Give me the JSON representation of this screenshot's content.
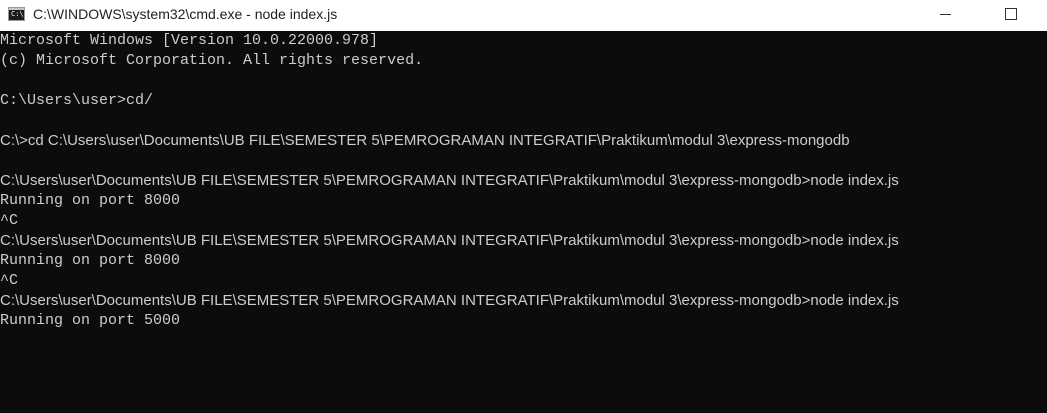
{
  "window": {
    "title": "C:\\WINDOWS\\system32\\cmd.exe - node  index.js",
    "icon": "cmd-icon",
    "icon_glyph": "C:\\",
    "controls": [
      "minimize-icon",
      "maximize-icon"
    ]
  },
  "colors": {
    "console_bg": "#0c0c0c",
    "console_text": "#cccccc",
    "titlebar_bg": "#ffffff"
  },
  "console": {
    "lines": [
      "Microsoft Windows [Version 10.0.22000.978]",
      "(c) Microsoft Corporation. All rights reserved.",
      "",
      "C:\\Users\\user>cd/",
      "",
      "C:\\>cd C:\\Users\\user\\Documents\\UB FILE\\SEMESTER 5\\PEMROGRAMAN INTEGRATIF\\Praktikum\\modul 3\\express-mongodb",
      "",
      "C:\\Users\\user\\Documents\\UB FILE\\SEMESTER 5\\PEMROGRAMAN INTEGRATIF\\Praktikum\\modul 3\\express-mongodb>node index.js",
      "Running on port 8000",
      "^C",
      "C:\\Users\\user\\Documents\\UB FILE\\SEMESTER 5\\PEMROGRAMAN INTEGRATIF\\Praktikum\\modul 3\\express-mongodb>node index.js",
      "Running on port 8000",
      "^C",
      "C:\\Users\\user\\Documents\\UB FILE\\SEMESTER 5\\PEMROGRAMAN INTEGRATIF\\Praktikum\\modul 3\\express-mongodb>node index.js",
      "Running on port 5000"
    ]
  }
}
